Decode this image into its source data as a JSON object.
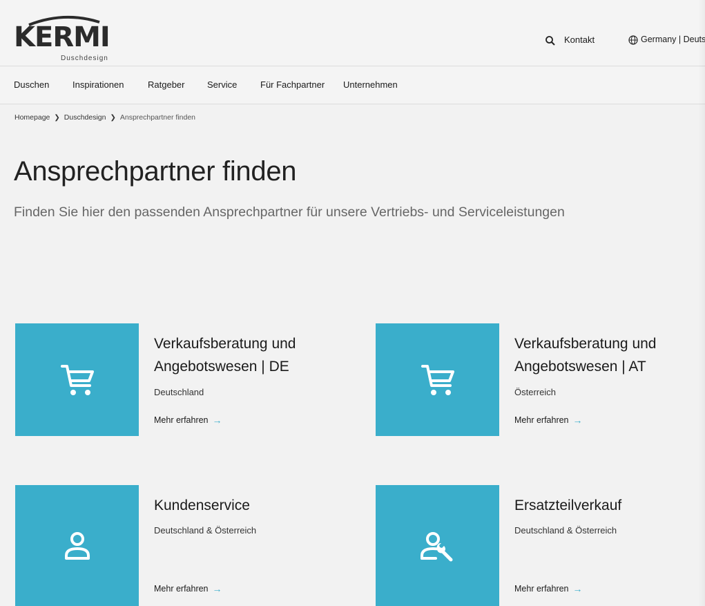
{
  "header": {
    "logo_text": "KERMI",
    "logo_sub": "Duschdesign",
    "contact_label": "Kontakt",
    "language_label": "Germany | Deutsch"
  },
  "nav": {
    "items": [
      {
        "label": "Duschen"
      },
      {
        "label": "Inspirationen"
      },
      {
        "label": "Ratgeber"
      },
      {
        "label": "Service"
      },
      {
        "label": "Für Fachpartner"
      },
      {
        "label": "Unternehmen"
      }
    ]
  },
  "breadcrumb": {
    "items": [
      "Homepage",
      "Duschdesign",
      "Ansprechpartner finden"
    ]
  },
  "page": {
    "title": "Ansprechpartner finden",
    "subtitle": "Finden Sie hier den passenden Ansprechpartner für unsere Vertriebs- und Serviceleistungen"
  },
  "cards": [
    {
      "title_line1": "Verkaufsberatung und",
      "title_line2": "Angebotswesen | DE",
      "subtitle": "Deutschland",
      "link": "Mehr erfahren",
      "icon": "shopping-cart-icon"
    },
    {
      "title_line1": "Verkaufsberatung und",
      "title_line2": "Angebotswesen | AT",
      "subtitle": "Österreich",
      "link": "Mehr erfahren",
      "icon": "shopping-cart-icon"
    },
    {
      "title_line1": "Kundenservice",
      "subtitle": "Deutschland & Österreich",
      "link": "Mehr erfahren",
      "icon": "person-icon"
    },
    {
      "title_line1": "Ersatzteilverkauf",
      "subtitle": "Deutschland & Österreich",
      "link": "Mehr erfahren",
      "icon": "person-wrench-icon"
    }
  ],
  "colors": {
    "accent": "#3aaecb",
    "background": "#f2f2f2"
  }
}
